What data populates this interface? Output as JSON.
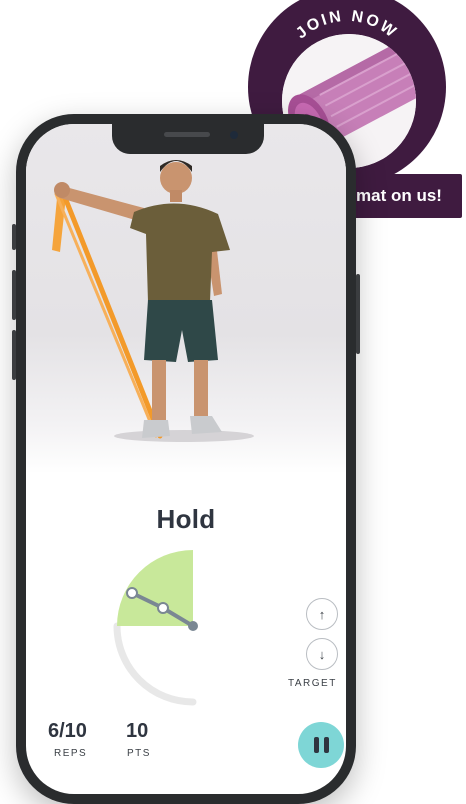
{
  "promo": {
    "badge_text": "JOIN NOW",
    "ribbon_text": "mat on us!"
  },
  "exercise": {
    "status": "Hold"
  },
  "target": {
    "label": "TARGET",
    "up_icon": "↑",
    "down_icon": "↓"
  },
  "stats": {
    "reps_value": "6/10",
    "reps_label": "REPS",
    "points_value": "10",
    "points_label": "PTS"
  },
  "colors": {
    "brand_purple": "#3f1b40",
    "gauge_fill": "#c8e89a",
    "pause_button": "#7ed6d6"
  }
}
